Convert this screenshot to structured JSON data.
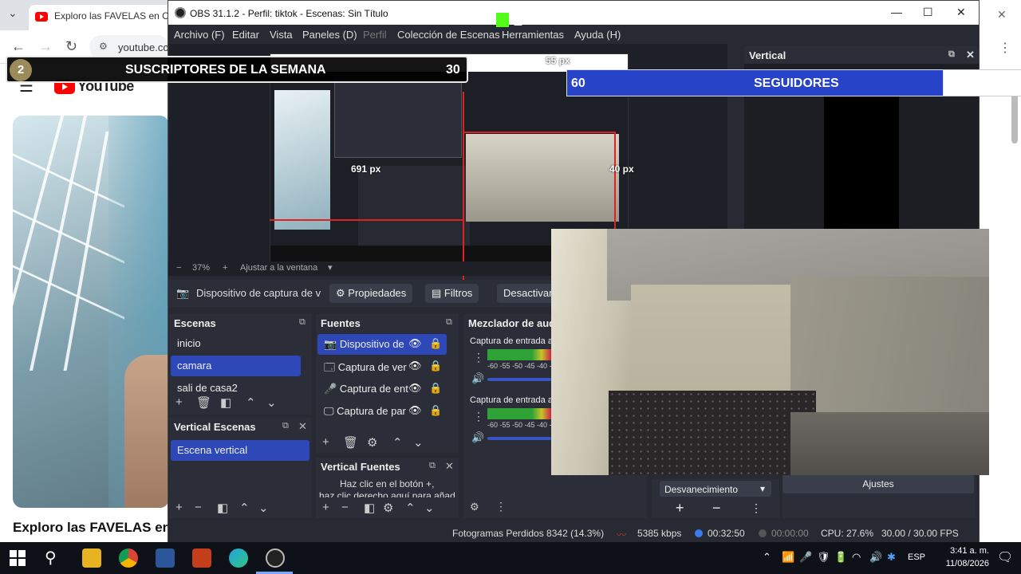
{
  "chrome": {
    "tab_title": "Exploro las FAVELAS en CO",
    "url": "youtube.co",
    "yt_logo_text": "YouTube",
    "video_title": "Exploro las FAVELAS en"
  },
  "obs": {
    "title": "OBS 31.1.2 - Perfil: tiktok - Escenas: Sin Título",
    "menu": [
      "Archivo (F)",
      "Editar",
      "Vista",
      "Paneles (D)",
      "Perfil",
      "Colección de Escenas",
      "Herramientas",
      "Ayuda (H)"
    ],
    "preview": {
      "px_top": "55 px",
      "px_left": "691 px",
      "px_right": "40 px",
      "zoom": "37%",
      "fit_label": "Ajustar a la ventana"
    },
    "sourcebar": {
      "source_name": "Dispositivo de captura de v",
      "properties": "Propiedades",
      "filters": "Filtros",
      "deactivate": "Desactivar"
    },
    "scenes": {
      "title": "Escenas",
      "items": [
        "inicio",
        "camara",
        "sali de casa2"
      ],
      "selected": "camara"
    },
    "sources": {
      "title": "Fuentes",
      "items": [
        "Dispositivo de",
        "Captura de ver",
        "Captura de ent",
        "Captura de par"
      ]
    },
    "mixer": {
      "title": "Mezclador de aud",
      "channels": [
        {
          "name": "Captura de entrada a"
        },
        {
          "name": "Captura de entrada a"
        }
      ],
      "scale": "-60 -55 -50 -45 -40 -3"
    },
    "vertical_scenes": {
      "title": "Vertical Escenas",
      "items": [
        "Escena vertical"
      ]
    },
    "vertical_sources": {
      "title": "Vertical Fuentes",
      "hint_line1": "Haz clic en el botón +,",
      "hint_line2": "haz clic derecho aquí para añad"
    },
    "vertical_panel": {
      "title": "Vertical"
    },
    "transition": {
      "value": "Desvanecimiento",
      "settings": "Ajustes"
    },
    "status": {
      "dropped": "Fotogramas Perdidos 8342 (14.3%)",
      "bitrate": "5385 kbps",
      "stream_time": "00:32:50",
      "rec_time": "00:00:00",
      "cpu": "CPU: 27.6%",
      "fps": "30.00 / 30.00 FPS"
    }
  },
  "overlays": {
    "subs_rank": "2",
    "subs_title": "SUSCRIPTORES DE LA SEMANA",
    "subs_count": "30",
    "followers_count": "60",
    "followers_label": "SEGUIDORES",
    "kick_count": "2"
  },
  "taskbar": {
    "lang": "ESP",
    "time": "3:41 a. m.",
    "date": "11/08/2026"
  }
}
